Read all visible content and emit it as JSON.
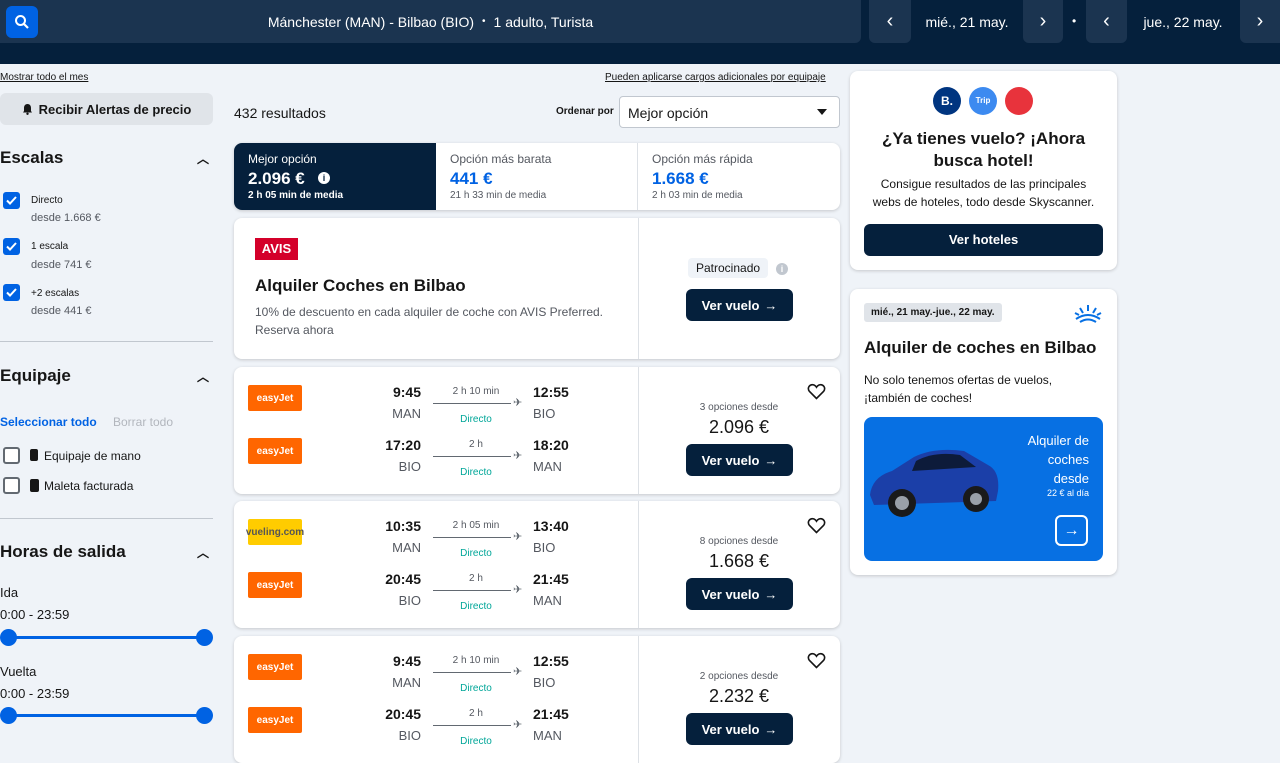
{
  "header": {
    "route": "Mánchester (MAN) - Bilbao (BIO)",
    "sep": "•",
    "passengers": "1 adulto, Turista",
    "dot": "•",
    "outbound_date": "mié., 21 may.",
    "return_date": "jue., 22 may."
  },
  "sidebar": {
    "show_month": "Mostrar todo el mes",
    "alerts": "Recibir Alertas de precio",
    "stops": {
      "title": "Escalas",
      "items": [
        {
          "label": "Directo",
          "sub": "desde 1.668 €",
          "checked": true
        },
        {
          "label": "1 escala",
          "sub": "desde 741 €",
          "checked": true
        },
        {
          "label": "+2 escalas",
          "sub": "desde 441 €",
          "checked": true
        }
      ]
    },
    "baggage": {
      "title": "Equipaje",
      "select_all": "Seleccionar todo",
      "clear_all": "Borrar todo",
      "items": [
        {
          "label": "Equipaje de mano",
          "checked": false
        },
        {
          "label": "Maleta facturada",
          "checked": false
        }
      ]
    },
    "times": {
      "title": "Horas de salida",
      "outbound_label": "Ida",
      "outbound_range": "0:00 - 23:59",
      "return_label": "Vuelta",
      "return_range": "0:00 - 23:59"
    }
  },
  "results": {
    "extra_fees": "Pueden aplicarse cargos adicionales por equipaje",
    "count": "432 resultados",
    "sort_label": "Ordenar por",
    "sort_value": "Mejor opción",
    "tabs": [
      {
        "label": "Mejor opción",
        "price": "2.096 €",
        "sub": "2 h 05 min de media"
      },
      {
        "label": "Opción más barata",
        "price": "441 €",
        "sub": "21 h 33 min de media"
      },
      {
        "label": "Opción más rápida",
        "price": "1.668 €",
        "sub": "2 h 03 min de media"
      }
    ],
    "ad": {
      "brand": "AVIS",
      "title": "Alquiler Coches en Bilbao",
      "desc1": "10% de descuento en cada alquiler de coche con AVIS Preferred.",
      "desc2": "Reserva ahora",
      "sponsored": "Patrocinado",
      "button": "Ver vuelo"
    },
    "flights": [
      {
        "options": "3 opciones desde",
        "price": "2.096 €",
        "button": "Ver vuelo",
        "legs": [
          {
            "airline": "easyJet",
            "dep": "9:45",
            "from": "MAN",
            "dur": "2 h 10 min",
            "stops": "Directo",
            "arr": "12:55",
            "to": "BIO"
          },
          {
            "airline": "easyJet",
            "dep": "17:20",
            "from": "BIO",
            "dur": "2 h",
            "stops": "Directo",
            "arr": "18:20",
            "to": "MAN"
          }
        ]
      },
      {
        "options": "8 opciones desde",
        "price": "1.668 €",
        "button": "Ver vuelo",
        "legs": [
          {
            "airline": "vueling.com",
            "dep": "10:35",
            "from": "MAN",
            "dur": "2 h 05 min",
            "stops": "Directo",
            "arr": "13:40",
            "to": "BIO"
          },
          {
            "airline": "easyJet",
            "dep": "20:45",
            "from": "BIO",
            "dur": "2 h",
            "stops": "Directo",
            "arr": "21:45",
            "to": "MAN"
          }
        ]
      },
      {
        "options": "2 opciones desde",
        "price": "2.232 €",
        "button": "Ver vuelo",
        "legs": [
          {
            "airline": "easyJet",
            "dep": "9:45",
            "from": "MAN",
            "dur": "2 h 10 min",
            "stops": "Directo",
            "arr": "12:55",
            "to": "BIO"
          },
          {
            "airline": "easyJet",
            "dep": "20:45",
            "from": "BIO",
            "dur": "2 h",
            "stops": "Directo",
            "arr": "21:45",
            "to": "MAN"
          }
        ]
      }
    ]
  },
  "right": {
    "hotel": {
      "logo1": "B.",
      "logo2": "Trip",
      "title1": "¿Ya tienes vuelo? ¡Ahora",
      "title2": "busca hotel!",
      "desc1": "Consigue resultados de las principales",
      "desc2": "webs de hoteles, todo desde Skyscanner.",
      "button": "Ver hoteles"
    },
    "cars": {
      "dates": "mié., 21 may.-jue., 22 may.",
      "title": "Alquiler de coches en Bilbao",
      "desc1": "No solo tenemos ofertas de vuelos,",
      "desc2": "¡también de coches!",
      "promo1": "Alquiler de",
      "promo2": "coches",
      "promo3": "desde",
      "promo_price": "22 € al día"
    }
  },
  "colors": {
    "navy": "#05203c",
    "blue": "#0062e3",
    "easyjet": "#ff6600",
    "vueling": "#ffcc00",
    "avis": "#d4002a"
  }
}
